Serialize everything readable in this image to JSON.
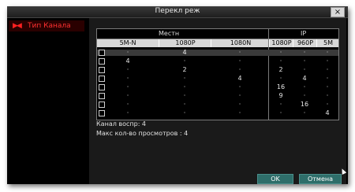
{
  "window": {
    "title": "Перекл реж",
    "close_icon": "×"
  },
  "sidebar": {
    "items": [
      {
        "label": "Тип Канала",
        "icon": "channel-arrows-icon"
      }
    ]
  },
  "table": {
    "group_headers": [
      "Местн",
      "IP"
    ],
    "columns": [
      "5M-N",
      "1080P",
      "1080N",
      "1080P",
      "960P",
      "5M"
    ],
    "rows": [
      [
        "·",
        "4",
        "·",
        "·",
        "·",
        "·"
      ],
      [
        "4",
        "·",
        "·",
        "·",
        "·",
        "·"
      ],
      [
        "·",
        "2",
        "·",
        "2",
        "·",
        "·"
      ],
      [
        "·",
        "·",
        "4",
        "·",
        "4",
        "·"
      ],
      [
        "·",
        "·",
        "·",
        "16",
        "·",
        "·"
      ],
      [
        "·",
        "·",
        "·",
        "9",
        "·",
        "·"
      ],
      [
        "·",
        "·",
        "·",
        "·",
        "16",
        "·"
      ],
      [
        "·",
        "·",
        "·",
        "·",
        "·",
        "4"
      ]
    ],
    "selected_row": 0
  },
  "info": {
    "playback_label": "Канал воспр: 4",
    "max_views_label": "Макс кол-во просмотров  : 4"
  },
  "buttons": {
    "ok": "OK",
    "cancel": "Отмена"
  },
  "colors": {
    "accent": "#ff3030",
    "button": "#2e6e6a",
    "header_bar": "#d8d8d8"
  }
}
